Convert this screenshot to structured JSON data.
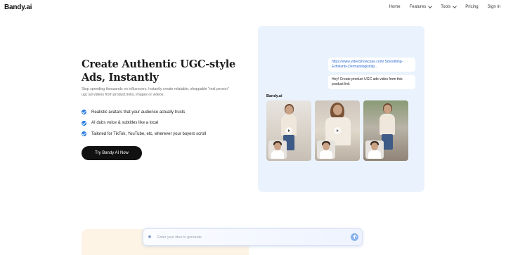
{
  "header": {
    "logo": "Bandy.ai",
    "nav": {
      "home": "Home",
      "features": "Features",
      "tools": "Tools",
      "pricing": "Pricing",
      "signin": "Sign in"
    }
  },
  "hero": {
    "title": "Create Authentic UGC-style Ads, Instantly",
    "subtitle": "Stop spending thousands on influencers. Instantly create relatable, shoppable \"real person\" ugc ad videos from product links, images or videos.",
    "features": [
      "Realistic avatars that your audience actually trusts",
      "AI dubs voice & subtitles like a local",
      "Tailored for TikTok, YouTube, etc, wherever your buyers scroll"
    ],
    "cta": "Try Bandy AI Now"
  },
  "demo": {
    "url_text": "https://www.videoShowcase.com/ Smoothing-Exfoliants-Dermatologist/dp...",
    "message": "Hey! Create product UGC ads video from this product link",
    "brand": "Bandy.ai",
    "videos": [
      "video-1",
      "video-2",
      "video-3"
    ]
  },
  "prompt": {
    "placeholder": "Enter your idea to generate"
  },
  "colors": {
    "accent": "#2a7de1",
    "cta_bg": "#111111",
    "card_bg": "#eaf3fd",
    "link": "#2c6bd1"
  }
}
